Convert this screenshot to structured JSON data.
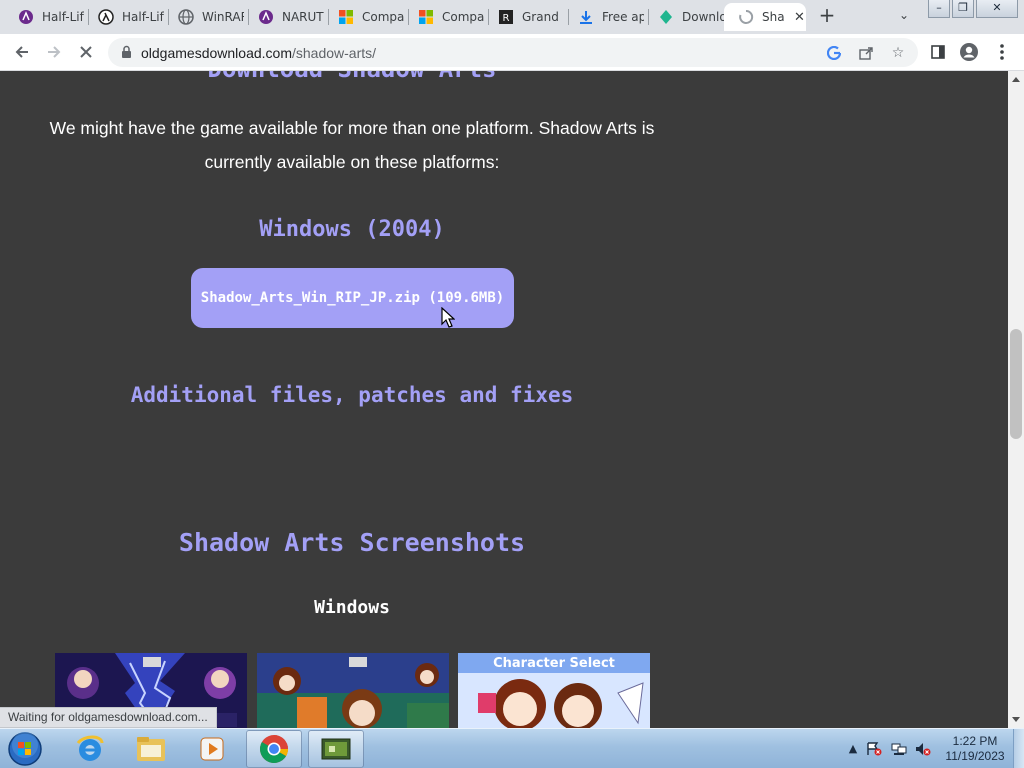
{
  "browser": {
    "tabs": [
      {
        "title": "Half-Life",
        "icon": "purple-globe-icon"
      },
      {
        "title": "Half-Life",
        "icon": "lambda-icon"
      },
      {
        "title": "WinRAR",
        "icon": "globe-icon"
      },
      {
        "title": "NARUTO",
        "icon": "purple-globe-icon"
      },
      {
        "title": "Compare",
        "icon": "microsoft-icon"
      },
      {
        "title": "Compare",
        "icon": "microsoft-icon"
      },
      {
        "title": "Grand",
        "icon": "rockstar-icon"
      },
      {
        "title": "Free ap",
        "icon": "download-arrow-icon"
      },
      {
        "title": "Downlo",
        "icon": "green-leaf-icon"
      },
      {
        "title": "Sha",
        "icon": "loading-spinner-icon",
        "active": true
      }
    ],
    "url_host": "oldgamesdownload.com",
    "url_path": "/shadow-arts/",
    "status_text": "Waiting for oldgamesdownload.com..."
  },
  "page": {
    "top_title": "Download Shadow Arts",
    "intro_text": "We might have the game available for more than one platform. Shadow Arts is currently available on these platforms:",
    "platform_heading": "Windows (2004)",
    "download_label": "Shadow_Arts_Win_RIP_JP.zip (109.6MB)",
    "extras_heading": "Additional files, patches and fixes",
    "screenshots_heading": "Shadow Arts Screenshots",
    "screenshots_sub": "Windows",
    "thumb3_caption": "Character Select"
  },
  "taskbar": {
    "time": "1:22 PM",
    "date": "11/19/2023"
  },
  "colors": {
    "page_bg": "#3b3b3b",
    "accent_purple": "#a3a0f6"
  }
}
